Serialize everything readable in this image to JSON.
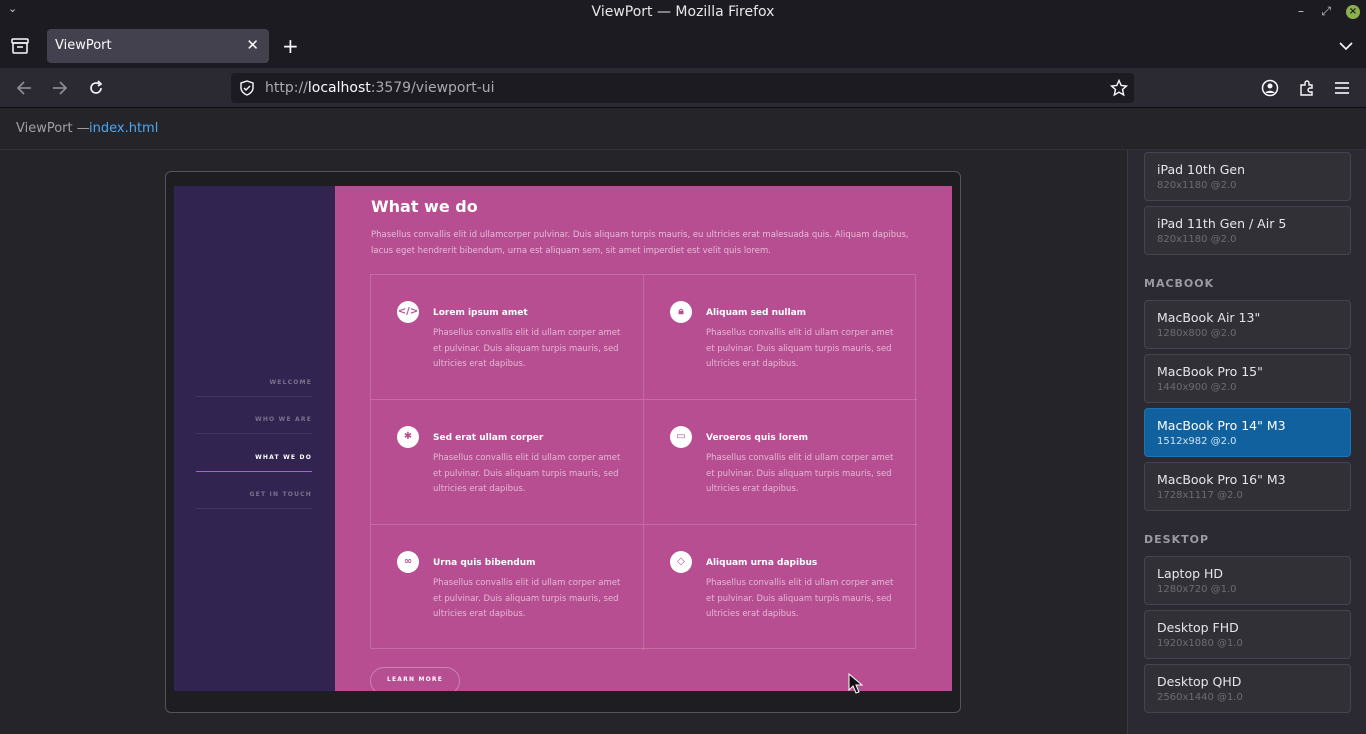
{
  "window": {
    "title": "ViewPort — Mozilla Firefox"
  },
  "tab": {
    "label": "ViewPort"
  },
  "urlbar": {
    "prefix": "http://",
    "host": "localhost",
    "rest": ":3579/viewport-ui"
  },
  "header": {
    "crumb_prefix": "ViewPort —",
    "crumb_file": "index.html"
  },
  "site": {
    "nav": [
      "WELCOME",
      "WHO WE ARE",
      "WHAT WE DO",
      "GET IN TOUCH"
    ],
    "title": "What we do",
    "intro": "Phasellus convallis elit id ullamcorper pulvinar. Duis aliquam turpis mauris, eu ultricies erat malesuada quis. Aliquam dapibus, lacus eget hendrerit bibendum, urna est aliquam sem, sit amet imperdiet est velit quis lorem.",
    "features": [
      {
        "title": "Lorem ipsum amet",
        "desc": "Phasellus convallis elit id ullam corper amet et pulvinar. Duis aliquam turpis mauris, sed ultricies erat dapibus.",
        "icon": "code-icon"
      },
      {
        "title": "Aliquam sed nullam",
        "desc": "Phasellus convallis elit id ullam corper amet et pulvinar. Duis aliquam turpis mauris, sed ultricies erat dapibus.",
        "icon": "lock-icon"
      },
      {
        "title": "Sed erat ullam corper",
        "desc": "Phasellus convallis elit id ullam corper amet et pulvinar. Duis aliquam turpis mauris, sed ultricies erat dapibus.",
        "icon": "cog-icon"
      },
      {
        "title": "Veroeros quis lorem",
        "desc": "Phasellus convallis elit id ullam corper amet et pulvinar. Duis aliquam turpis mauris, sed ultricies erat dapibus.",
        "icon": "desktop-icon"
      },
      {
        "title": "Urna quis bibendum",
        "desc": "Phasellus convallis elit id ullam corper amet et pulvinar. Duis aliquam turpis mauris, sed ultricies erat dapibus.",
        "icon": "link-icon"
      },
      {
        "title": "Aliquam urna dapibus",
        "desc": "Phasellus convallis elit id ullam corper amet et pulvinar. Duis aliquam turpis mauris, sed ultricies erat dapibus.",
        "icon": "gem-icon"
      }
    ],
    "learn_more": "LEARN MORE"
  },
  "panel": {
    "ipad": [
      {
        "name": "iPad 10th Gen",
        "spec": "820x1180 @2.0"
      },
      {
        "name": "iPad 11th Gen / Air 5",
        "spec": "820x1180 @2.0"
      }
    ],
    "macbook_label": "MACBOOK",
    "macbook": [
      {
        "name": "MacBook Air 13\"",
        "spec": "1280x800 @2.0"
      },
      {
        "name": "MacBook Pro 15\"",
        "spec": "1440x900 @2.0"
      },
      {
        "name": "MacBook Pro 14\" M3",
        "spec": "1512x982 @2.0"
      },
      {
        "name": "MacBook Pro 16\" M3",
        "spec": "1728x1117 @2.0"
      }
    ],
    "desktop_label": "DESKTOP",
    "desktop": [
      {
        "name": "Laptop HD",
        "spec": "1280x720 @1.0"
      },
      {
        "name": "Desktop FHD",
        "spec": "1920x1080 @1.0"
      },
      {
        "name": "Desktop QHD",
        "spec": "2560x1440 @1.0"
      }
    ]
  },
  "colors": {
    "accent": "#10619e",
    "site_sidebar": "#312450",
    "site_main": "#b74e91"
  }
}
